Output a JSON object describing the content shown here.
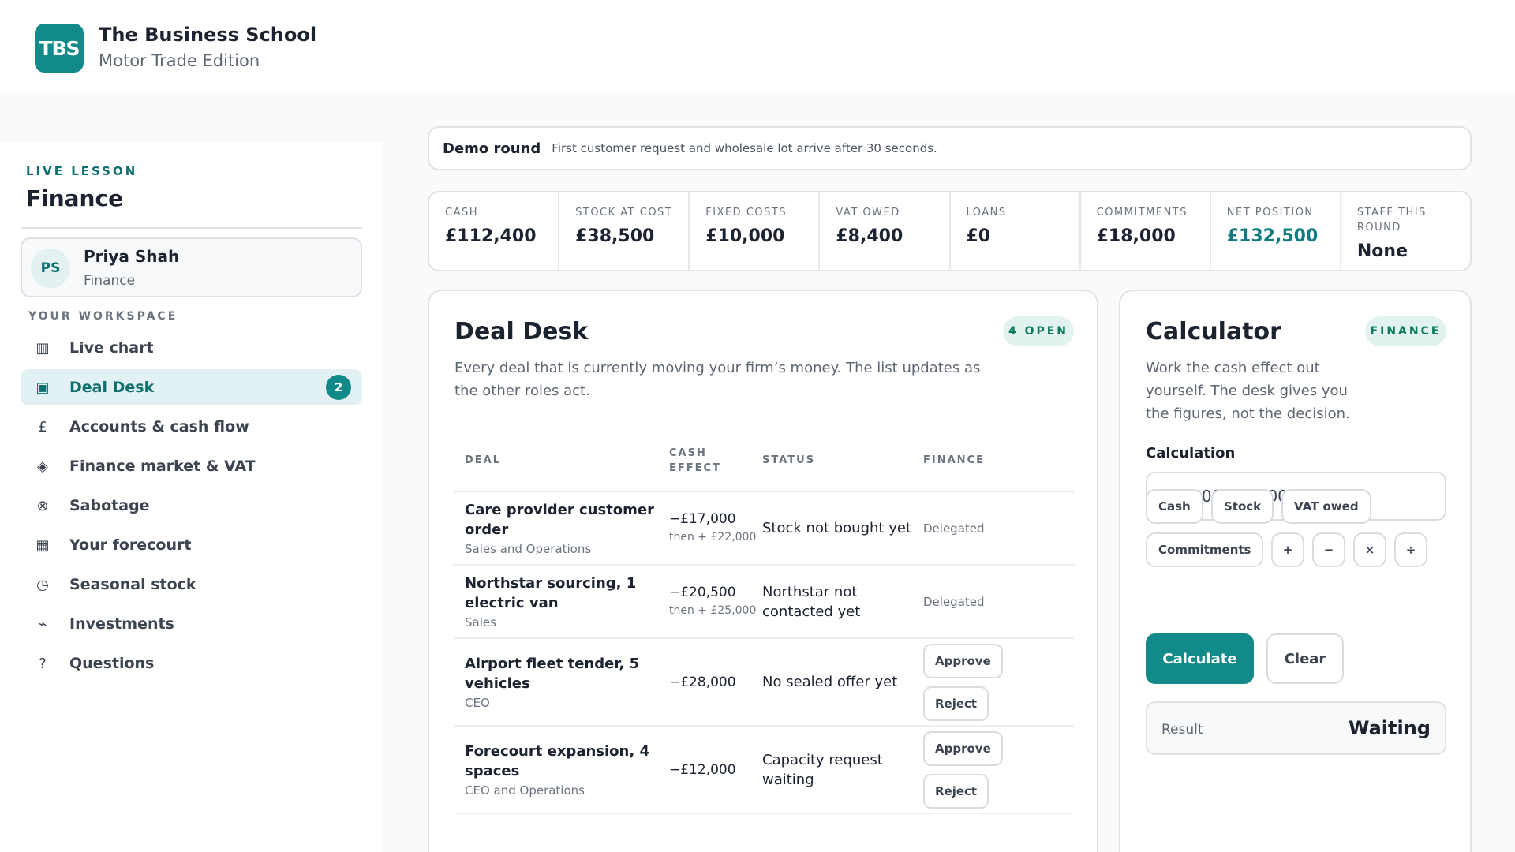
{
  "brand": {
    "logo_text": "TBS",
    "title": "The Business School",
    "subtitle": "Motor Trade Edition"
  },
  "sidebar": {
    "lesson_label": "LIVE LESSON",
    "lesson_title": "Finance",
    "user": {
      "initials": "PS",
      "name": "Priya Shah",
      "role": "Finance"
    },
    "workspace_label": "YOUR WORKSPACE",
    "items": [
      {
        "icon": "bar-chart-icon",
        "glyph": "▥",
        "label": "Live chart"
      },
      {
        "icon": "deal-desk-icon",
        "glyph": "▣",
        "label": "Deal Desk",
        "badge": "2",
        "active": true
      },
      {
        "icon": "pound-icon",
        "glyph": "£",
        "label": "Accounts & cash flow"
      },
      {
        "icon": "diamond-icon",
        "glyph": "◈",
        "label": "Finance market & VAT"
      },
      {
        "icon": "sabotage-icon",
        "glyph": "⊗",
        "label": "Sabotage"
      },
      {
        "icon": "grid-icon",
        "glyph": "▦",
        "label": "Your forecourt"
      },
      {
        "icon": "clock-icon",
        "glyph": "◷",
        "label": "Seasonal stock"
      },
      {
        "icon": "trend-icon",
        "glyph": "⌁",
        "label": "Investments"
      },
      {
        "icon": "question-icon",
        "glyph": "?",
        "label": "Questions"
      }
    ]
  },
  "banner": {
    "title": "Demo round",
    "text": "First customer request and wholesale lot arrive after 30 seconds."
  },
  "stats": [
    {
      "label": "CASH",
      "value": "£112,400"
    },
    {
      "label": "STOCK AT COST",
      "value": "£38,500"
    },
    {
      "label": "FIXED COSTS",
      "value": "£10,000"
    },
    {
      "label": "VAT OWED",
      "value": "£8,400"
    },
    {
      "label": "LOANS",
      "value": "£0"
    },
    {
      "label": "COMMITMENTS",
      "value": "£18,000"
    },
    {
      "label": "NET POSITION",
      "value": "£132,500",
      "accent": "#0f7b80"
    },
    {
      "label": "STAFF THIS ROUND",
      "value": "None"
    }
  ],
  "deal_desk": {
    "title": "Deal Desk",
    "badge": "4 OPEN",
    "description": "Every deal that is currently moving your firm’s money. The list updates as the other roles act.",
    "columns": [
      "DEAL",
      "CASH EFFECT",
      "STATUS",
      "FINANCE"
    ],
    "rows": [
      {
        "name": "Care provider customer order",
        "owner": "Sales and Operations",
        "cash": "−£17,000",
        "cash_then": "then + £22,000",
        "status": "Stock not bought yet",
        "finance": "Delegated"
      },
      {
        "name": "Northstar sourcing, 1 electric van",
        "owner": "Sales",
        "cash": "−£20,500",
        "cash_then": "then + £25,000",
        "status": "Northstar not contacted yet",
        "finance": "Delegated"
      },
      {
        "name": "Airport fleet tender, 5 vehicles",
        "owner": "CEO",
        "cash": "−£28,000",
        "cash_then": "",
        "status": "No sealed offer yet",
        "finance": "",
        "actions": [
          "Approve",
          "Reject"
        ]
      },
      {
        "name": "Forecourt expansion, 4 spaces",
        "owner": "CEO and Operations",
        "cash": "−£12,000",
        "cash_then": "",
        "status": "Capacity request waiting",
        "finance": "",
        "actions": [
          "Approve",
          "Reject"
        ]
      }
    ]
  },
  "calculator": {
    "title": "Calculator",
    "badge": "FINANCE",
    "description": "Work the cash effect out yourself. The desk gives you the figures, not the decision.",
    "input_label": "Calculation",
    "input_value": "112400 - 28000",
    "chips": [
      "Cash",
      "Stock",
      "VAT owed",
      "Commitments"
    ],
    "operators": [
      "+",
      "−",
      "×",
      "÷"
    ],
    "calculate_label": "Calculate",
    "clear_label": "Clear",
    "result_label": "Result",
    "result_value": "Waiting"
  },
  "colors": {
    "brand": "#128a8a",
    "accent_text": "#0f6f6f",
    "open_badge": "#0a7a5c"
  }
}
